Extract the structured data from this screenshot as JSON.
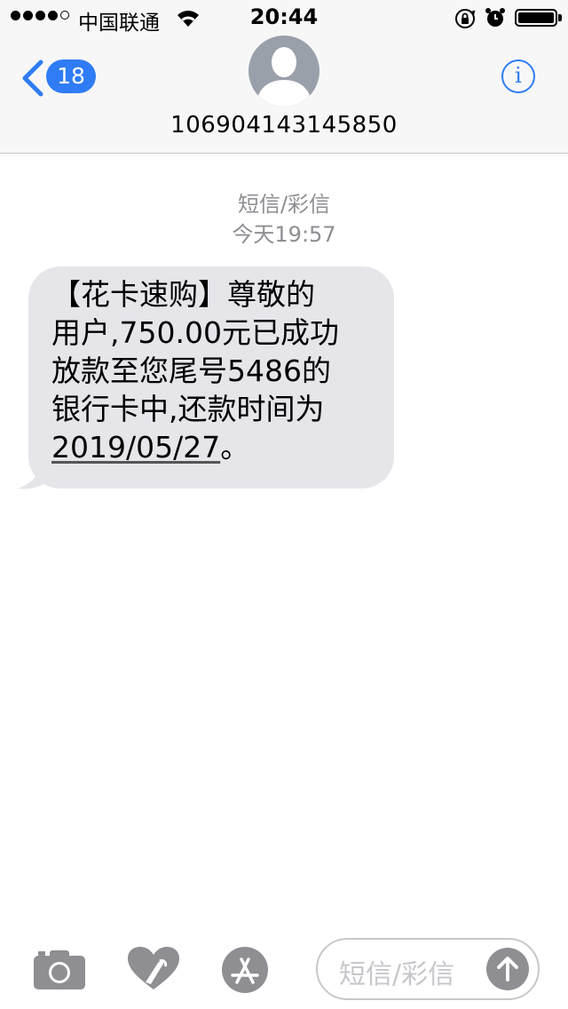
{
  "status_bar": {
    "carrier": "中国联通",
    "time": "20:44"
  },
  "header": {
    "back_badge": "18",
    "contact_number": "106904143145850",
    "info_label": "i"
  },
  "thread": {
    "message_type": "短信/彩信",
    "timestamp": "今天19:57"
  },
  "message": {
    "lines": [
      "【花卡速购】尊敬的",
      "用户,750.00元已成功",
      "放款至您尾号5486的",
      "银行卡中,还款时间为"
    ],
    "date_link": "2019/05/27",
    "end_punct": "。"
  },
  "input": {
    "placeholder": "短信/彩信"
  },
  "colors": {
    "accent": "#2f7cf6",
    "bubble": "#e5e5ea",
    "meta_text": "#8e8e93"
  }
}
